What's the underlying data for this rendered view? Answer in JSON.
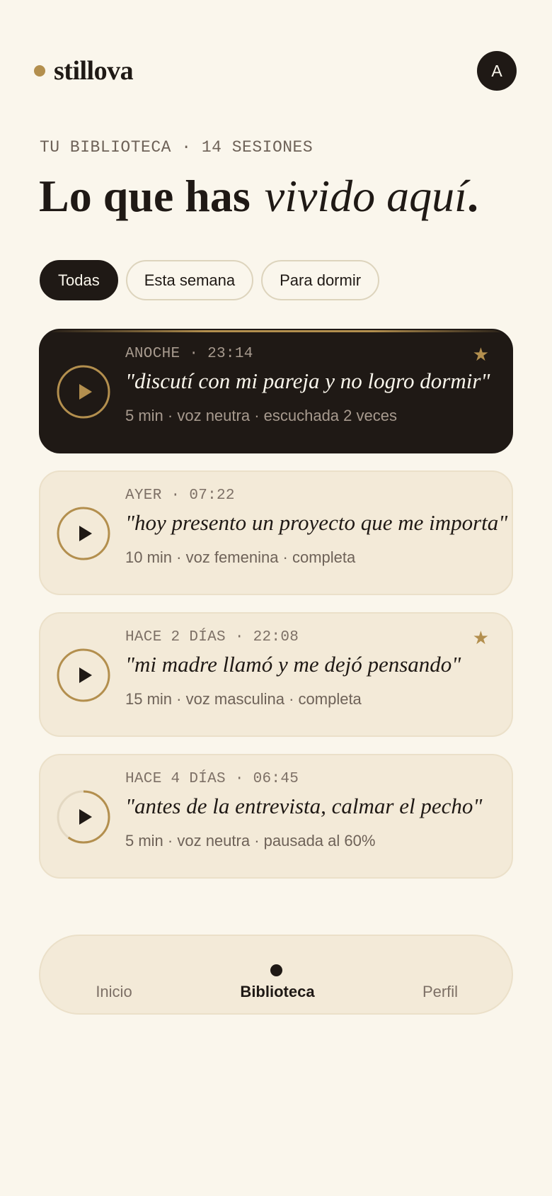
{
  "app": {
    "brand_name": "stillova",
    "avatar_initial": "A"
  },
  "library": {
    "eyebrow": "TU BIBLIOTECA · 14 SESIONES",
    "headline_bold": "Lo que has",
    "headline_italic": "vivido aquí",
    "headline_period": "."
  },
  "filters": [
    {
      "label": "Todas",
      "active": true
    },
    {
      "label": "Esta semana",
      "active": false
    },
    {
      "label": "Para dormir",
      "active": false
    }
  ],
  "sessions": [
    {
      "when": "ANOCHE · 23:14",
      "quote": "\"discutí con mi pareja y no logro dormir\"",
      "detail": "5 min · voz neutra · escuchada 2 veces",
      "starred": true,
      "star_glyph": "★",
      "progress": 1.0,
      "highlighted": true
    },
    {
      "when": "AYER · 07:22",
      "quote": "\"hoy presento un proyecto que me importa\"",
      "detail": "10 min · voz femenina · completa",
      "starred": false,
      "progress": 1.0,
      "highlighted": false
    },
    {
      "when": "HACE 2 DÍAS · 22:08",
      "quote": "\"mi madre llamó y me dejó pensando\"",
      "detail": "15 min · voz masculina · completa",
      "starred": true,
      "star_glyph": "★",
      "progress": 1.0,
      "highlighted": false
    },
    {
      "when": "HACE 4 DÍAS · 06:45",
      "quote": "\"antes de la entrevista, calmar el pecho\"",
      "detail": "5 min · voz neutra · pausada al 60%",
      "starred": false,
      "progress": 0.6,
      "highlighted": false
    }
  ],
  "bottom_nav": {
    "inicio": "Inicio",
    "biblioteca": "Biblioteca",
    "perfil": "Perfil",
    "active": "biblioteca"
  },
  "colors": {
    "background": "#faf6ec",
    "ink": "#1f1915",
    "accent_gold": "#b38f4e",
    "card_bg": "#f3ead8",
    "muted_text": "#6e6258"
  },
  "icons": {
    "play": "play-icon",
    "star": "star-icon",
    "brand_dot": "brand-dot-icon"
  }
}
